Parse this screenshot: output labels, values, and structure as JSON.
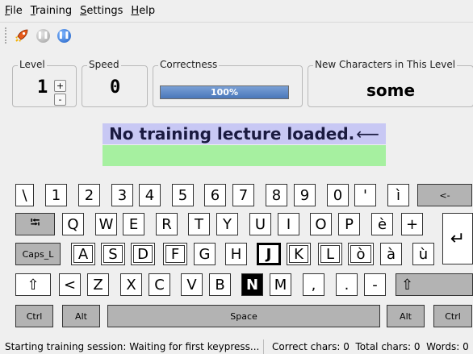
{
  "menu": [
    {
      "label": "File",
      "mnemonic": "F",
      "rest": "ile"
    },
    {
      "label": "Training",
      "mnemonic": "T",
      "rest": "raining"
    },
    {
      "label": "Settings",
      "mnemonic": "S",
      "rest": "ettings"
    },
    {
      "label": "Help",
      "mnemonic": "H",
      "rest": "elp"
    }
  ],
  "toolbar": {
    "icons": [
      "rocket-icon",
      "pause-icon-gray",
      "pause-icon-blue"
    ]
  },
  "level": {
    "title": "Level",
    "value": "1",
    "up": "+",
    "down": "-"
  },
  "speed": {
    "title": "Speed",
    "value": "0"
  },
  "correctness": {
    "title": "Correctness",
    "value": "100%",
    "fraction": 1.0
  },
  "new_chars": {
    "title": "New Characters in This Level",
    "value": "some"
  },
  "lecture": {
    "text": "No training lecture loaded.",
    "enter_glyph": "⟵"
  },
  "keyboard": {
    "row1": [
      "\\",
      "1",
      "2",
      "3",
      "4",
      "5",
      "6",
      "7",
      "8",
      "9",
      "0",
      "'",
      "ì",
      "<-"
    ],
    "row2": [
      "⭾",
      "Q",
      "W",
      "E",
      "R",
      "T",
      "Y",
      "U",
      "I",
      "O",
      "P",
      "è",
      "+",
      "↵"
    ],
    "row3": [
      "Caps_L",
      "A",
      "S",
      "D",
      "F",
      "G",
      "H",
      "J",
      "K",
      "L",
      "ò",
      "à",
      "ù"
    ],
    "row4": [
      "⇧",
      "<",
      "Z",
      "X",
      "C",
      "V",
      "B",
      "N",
      "M",
      ",",
      ".",
      "-",
      "⇧"
    ],
    "row5": [
      "Ctrl",
      "Alt",
      "Space",
      "Alt",
      "Ctrl"
    ]
  },
  "status": {
    "left": "Starting training session: Waiting for first keypress...",
    "right": "Correct chars: 0  Total chars: 0  Words: 0"
  }
}
